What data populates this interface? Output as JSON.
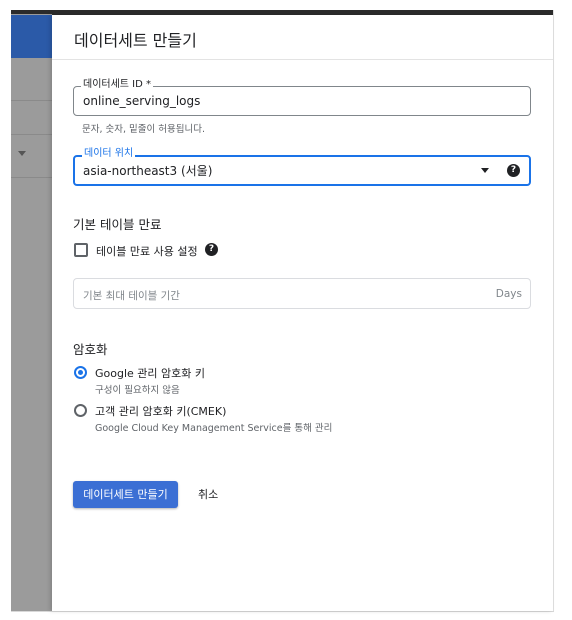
{
  "drawer": {
    "title": "데이터세트 만들기"
  },
  "dataset_id": {
    "label": "데이터세트 ID *",
    "value": "online_serving_logs",
    "hint": "문자, 숫자, 밑줄이 허용됩니다."
  },
  "location": {
    "label": "데이터 위치",
    "value": "asia-northeast3 (서울)",
    "help_icon": "?"
  },
  "table_expiration": {
    "section_title": "기본 테이블 만료",
    "checkbox_label": "테이블 만료 사용 설정",
    "checkbox_checked": false,
    "help_icon": "?",
    "days_placeholder": "기본 최대 테이블 기간",
    "days_suffix": "Days"
  },
  "encryption": {
    "section_title": "암호화",
    "options": [
      {
        "label": "Google 관리 암호화 키",
        "sub": "구성이 필요하지 않음",
        "selected": true
      },
      {
        "label": "고객 관리 암호화 키(CMEK)",
        "sub": "Google Cloud Key Management Service를 통해 관리",
        "selected": false
      }
    ]
  },
  "actions": {
    "create_label": "데이터세트 만들기",
    "cancel_label": "취소"
  },
  "colors": {
    "accent": "#1a73e8",
    "primary_button": "#3b6fd4"
  }
}
